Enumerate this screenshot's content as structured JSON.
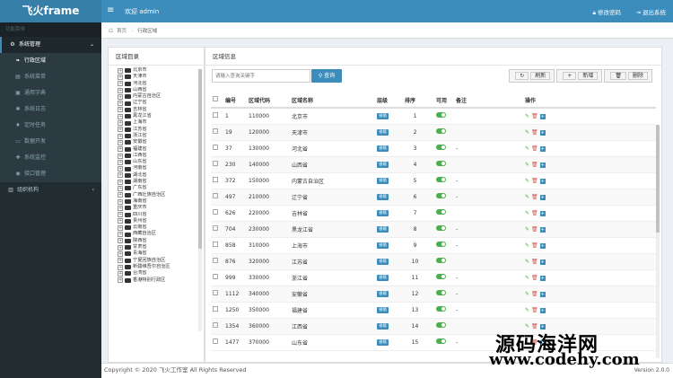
{
  "app": {
    "logo": "飞火frame",
    "welcome": "欢迎 admin",
    "change_pwd": "修改密码",
    "logout": "退出系统"
  },
  "sidebar": {
    "nav_header": "功能菜单",
    "parent": "系统管理",
    "items": [
      "行政区域",
      "系统菜单",
      "通用字典",
      "系统日志",
      "定时任务",
      "数据开发",
      "系统监控",
      "接口管理"
    ],
    "org": "组织机构"
  },
  "breadcrumb": {
    "home": "首页",
    "current": "行政区域"
  },
  "left_panel": {
    "title": "区域目录",
    "tree": [
      "北京市",
      "天津市",
      "河北省",
      "山西省",
      "内蒙古自治区",
      "辽宁省",
      "吉林省",
      "黑龙江省",
      "上海市",
      "江苏省",
      "浙江省",
      "安徽省",
      "福建省",
      "江西省",
      "山东省",
      "河南省",
      "湖北省",
      "湖南省",
      "广东省",
      "广西壮族自治区",
      "海南省",
      "重庆市",
      "四川省",
      "贵州省",
      "云南省",
      "西藏自治区",
      "陕西省",
      "甘肃省",
      "青海省",
      "宁夏回族自治区",
      "新疆维吾尔自治区",
      "台湾省",
      "香港特别行政区"
    ]
  },
  "right_panel": {
    "title": "区域信息",
    "search_placeholder": "请输入查询关键字",
    "query": "查询",
    "refresh": "刷新",
    "add": "新增",
    "delete": "删除"
  },
  "table": {
    "headers": [
      "",
      "编号",
      "区域代码",
      "区域名称",
      "层级",
      "排序",
      "可用",
      "备注",
      "操作"
    ],
    "level_label": "省级",
    "rows": [
      [
        "1",
        "110000",
        "北京市",
        "1",
        ""
      ],
      [
        "19",
        "120000",
        "天津市",
        "2",
        ""
      ],
      [
        "37",
        "130000",
        "河北省",
        "3",
        "-"
      ],
      [
        "230",
        "140000",
        "山西省",
        "4",
        ""
      ],
      [
        "372",
        "150000",
        "内蒙古自治区",
        "5",
        "-"
      ],
      [
        "497",
        "210000",
        "辽宁省",
        "6",
        "-"
      ],
      [
        "626",
        "220000",
        "吉林省",
        "7",
        ""
      ],
      [
        "704",
        "230000",
        "黑龙江省",
        "8",
        "-"
      ],
      [
        "858",
        "310000",
        "上海市",
        "9",
        "-"
      ],
      [
        "876",
        "320000",
        "江苏省",
        "10",
        ""
      ],
      [
        "999",
        "330000",
        "浙江省",
        "11",
        "-"
      ],
      [
        "1112",
        "340000",
        "安徽省",
        "12",
        "-"
      ],
      [
        "1250",
        "350000",
        "福建省",
        "13",
        "-"
      ],
      [
        "1354",
        "360000",
        "江西省",
        "14",
        ""
      ],
      [
        "1477",
        "370000",
        "山东省",
        "15",
        "-"
      ]
    ]
  },
  "footer": {
    "copyright": "Copyright © 2020 飞火工作室 All Rights Reserved",
    "version": "Version 2.0.0"
  },
  "watermark": {
    "line1": "源码海洋网",
    "line2": "www.codehy.com"
  }
}
